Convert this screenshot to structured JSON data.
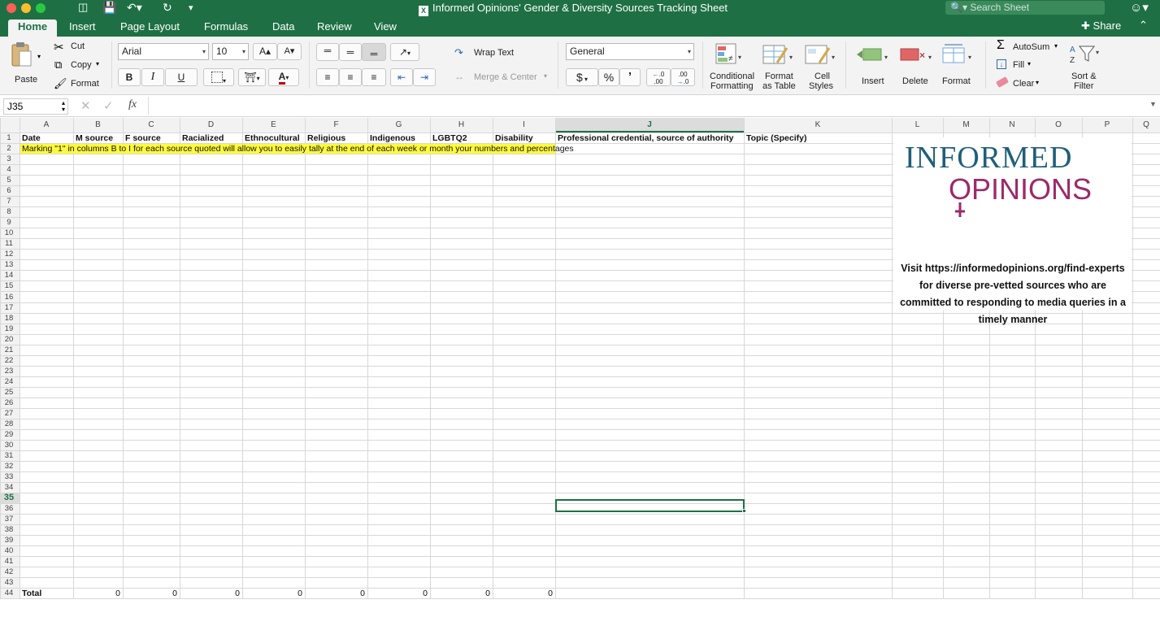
{
  "window": {
    "title": "Informed Opinions' Gender & Diversity Sources Tracking Sheet",
    "search_placeholder": "Search Sheet"
  },
  "tabs": [
    {
      "label": "Home",
      "active": true
    },
    {
      "label": "Insert"
    },
    {
      "label": "Page Layout"
    },
    {
      "label": "Formulas"
    },
    {
      "label": "Data"
    },
    {
      "label": "Review"
    },
    {
      "label": "View"
    }
  ],
  "share_label": "Share",
  "ribbon": {
    "paste": "Paste",
    "cut": "Cut",
    "copy": "Copy",
    "format_painter": "Format",
    "font_name": "Arial",
    "font_size": "10",
    "bold": "B",
    "italic": "I",
    "underline": "U",
    "wrap_text": "Wrap Text",
    "merge_center": "Merge & Center",
    "number_format": "General",
    "currency": "$",
    "percent": "%",
    "comma": "’",
    "conditional_formatting": [
      "Conditional",
      "Formatting"
    ],
    "format_as_table": [
      "Format",
      "as Table"
    ],
    "cell_styles": [
      "Cell",
      "Styles"
    ],
    "insert": "Insert",
    "delete": "Delete",
    "format": "Format",
    "autosum": "AutoSum",
    "fill": "Fill",
    "clear": "Clear",
    "sort_filter": [
      "Sort &",
      "Filter"
    ]
  },
  "formula_bar": {
    "name_box": "J35",
    "fx": "fx",
    "content": ""
  },
  "sheet": {
    "columns": [
      "A",
      "B",
      "C",
      "D",
      "E",
      "F",
      "G",
      "H",
      "I",
      "J",
      "K",
      "L",
      "M",
      "N",
      "O",
      "P",
      "Q"
    ],
    "selected_column": "J",
    "selected_row": "35",
    "row_numbers": [
      "1",
      "2",
      "3",
      "4",
      "5",
      "6",
      "7",
      "8",
      "9",
      "10",
      "11",
      "12",
      "13",
      "14",
      "15",
      "16",
      "17",
      "18",
      "19",
      "20",
      "21",
      "22",
      "23",
      "24",
      "25",
      "26",
      "27",
      "28",
      "29",
      "30",
      "31",
      "32",
      "33",
      "34",
      "35",
      "36",
      "37",
      "38",
      "39",
      "40",
      "41",
      "42",
      "43",
      "44"
    ],
    "headers": [
      "Date",
      "M source",
      "F source",
      "Racialized",
      "Ethnocultural",
      "Religious",
      "Indigenous",
      "LGBTQ2",
      "Disability",
      "Professional credential, source of authority",
      "Topic (Specify)"
    ],
    "note": "Marking \"1\" in columns B to I for each source quoted will allow you to easily tally at the end of each week or month your numbers and percentages",
    "total_label": "Total",
    "totals": [
      "0",
      "0",
      "0",
      "0",
      "0",
      "0",
      "0",
      "0"
    ]
  },
  "logo": {
    "word1": "INFORMED",
    "word2": "OPINIONS",
    "color1": "#1f5f7a",
    "color2": "#9c2a6a",
    "caption": "Visit https://informedopinions.org/find-experts for diverse pre-vetted sources who are committed to responding to media queries in a timely manner"
  }
}
